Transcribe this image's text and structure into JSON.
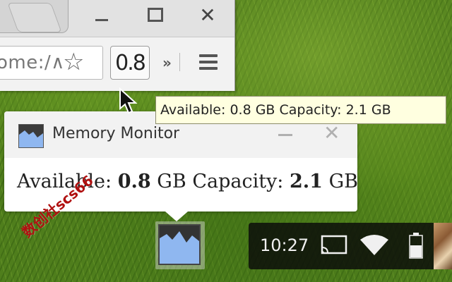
{
  "browser": {
    "omnibox_text": "ome:/∧",
    "extension_badge": "0.8",
    "overflow_chevron": "»",
    "window_close_glyph": "✕",
    "star_glyph": "☆"
  },
  "tooltip": {
    "text": "Available: 0.8 GB Capacity: 2.1 GB"
  },
  "notification": {
    "title": "Memory Monitor",
    "available_label": "Available:",
    "available_value": "0.8",
    "available_unit": "GB",
    "capacity_label": "Capacity:",
    "capacity_value": "2.1",
    "capacity_unit": "GB",
    "close_glyph": "✕"
  },
  "shelf": {
    "clock": "10:27",
    "icons": [
      "memory-monitor-icon",
      "cast-icon",
      "wifi-icon",
      "battery-icon"
    ]
  },
  "watermark": {
    "text": "数创社scs66"
  },
  "colors": {
    "tooltip_bg": "#ffffe0",
    "shelf_bg": "#111111",
    "app_icon_bg": "#8fb7f0",
    "watermark": "#b01010"
  }
}
